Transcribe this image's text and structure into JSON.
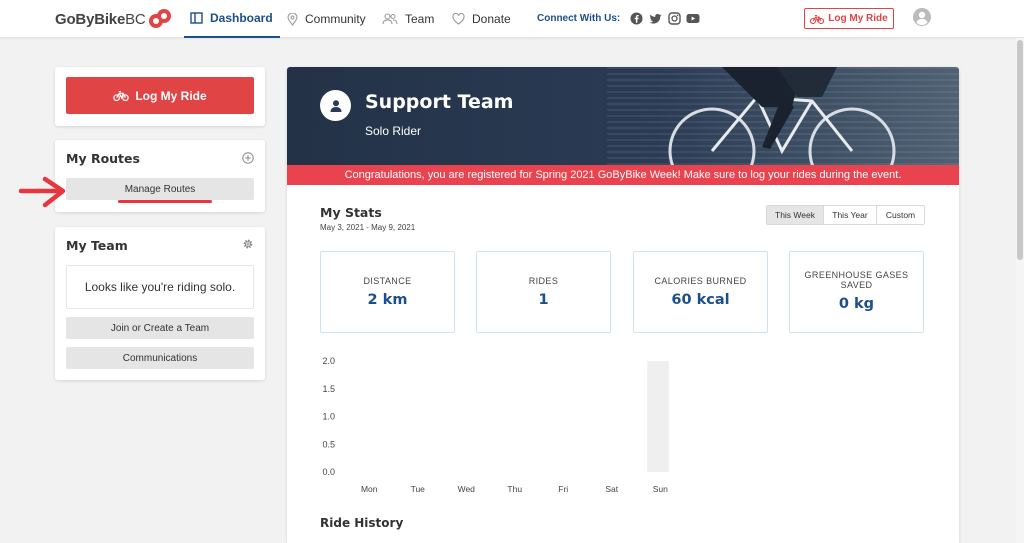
{
  "header": {
    "logo": {
      "main": "GoByBike",
      "suffix": "BC"
    },
    "nav": {
      "dashboard": "Dashboard",
      "community": "Community",
      "team": "Team",
      "donate": "Donate"
    },
    "connect_label": "Connect With Us:",
    "log_ride_label": "Log My Ride"
  },
  "sidebar": {
    "log_ride_label": "Log My Ride",
    "routes": {
      "title": "My Routes",
      "manage_label": "Manage Routes"
    },
    "team": {
      "title": "My Team",
      "solo_message": "Looks like you're riding solo.",
      "join_label": "Join or Create a Team",
      "communications_label": "Communications"
    }
  },
  "banner": {
    "title": "Support Team",
    "subtitle": "Solo Rider",
    "notice": "Congratulations, you are registered for Spring 2021 GoByBike Week! Make sure to log your rides during the event."
  },
  "stats": {
    "title": "My Stats",
    "date_range": "May 3, 2021 - May 9, 2021",
    "periods": [
      "This Week",
      "This Year",
      "Custom"
    ],
    "active_period": "This Week",
    "cards": [
      {
        "label": "DISTANCE",
        "value": "2 km"
      },
      {
        "label": "RIDES",
        "value": "1"
      },
      {
        "label": "CALORIES BURNED",
        "value": "60 kcal"
      },
      {
        "label": "GREENHOUSE GASES SAVED",
        "value": "0 kg"
      }
    ]
  },
  "chart_data": {
    "type": "bar",
    "categories": [
      "Mon",
      "Tue",
      "Wed",
      "Thu",
      "Fri",
      "Sat",
      "Sun"
    ],
    "values": [
      0,
      0,
      0,
      0,
      0,
      0,
      2
    ],
    "yticks": [
      "0.0",
      "0.5",
      "1.0",
      "1.5",
      "2.0"
    ],
    "ylim": [
      0,
      2
    ],
    "bar_color": "#efefef",
    "grid": false
  },
  "ride_history": {
    "title": "Ride History"
  },
  "colors": {
    "accent_red": "#e04444",
    "notice_red": "#ea4350",
    "brand_blue": "#1d4f8a"
  }
}
